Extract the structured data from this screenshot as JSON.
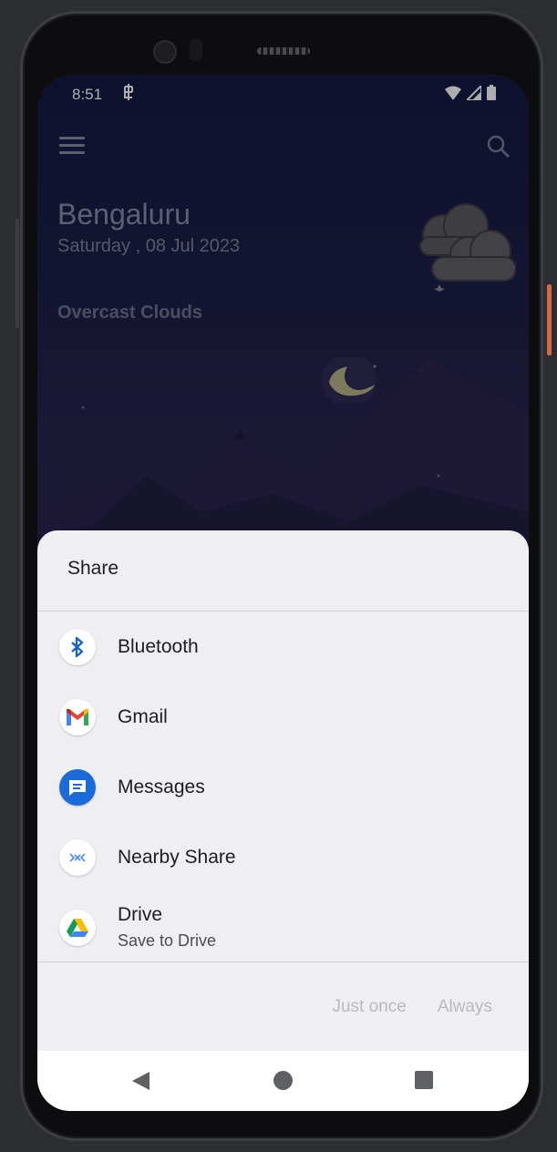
{
  "status_bar": {
    "time": "8:51"
  },
  "weather": {
    "city": "Bengaluru",
    "date": "Saturday , 08 Jul 2023",
    "condition": "Overcast Clouds"
  },
  "share_sheet": {
    "title": "Share",
    "apps": [
      {
        "label": "Bluetooth",
        "icon": "bluetooth-icon"
      },
      {
        "label": "Gmail",
        "icon": "gmail-icon"
      },
      {
        "label": "Messages",
        "icon": "messages-icon"
      },
      {
        "label": "Nearby Share",
        "icon": "nearby-share-icon"
      },
      {
        "label": "Drive",
        "sublabel": "Save to Drive",
        "icon": "drive-icon"
      }
    ],
    "actions": {
      "just_once": "Just once",
      "always": "Always"
    }
  },
  "colors": {
    "sheet_background": "#efeff2",
    "wallpaper": "#1a1c45",
    "power_button": "#d36a45"
  }
}
